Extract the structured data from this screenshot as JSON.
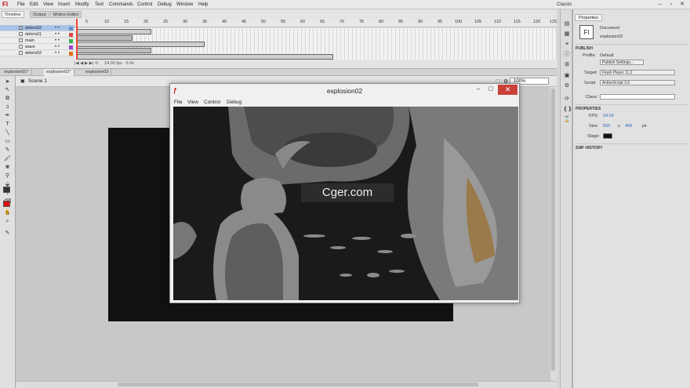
{
  "menubar": {
    "logo": "Fl",
    "items": [
      "File",
      "Edit",
      "View",
      "Insert",
      "Modify",
      "Text",
      "Commands",
      "Control",
      "Debug",
      "Window",
      "Help"
    ],
    "workspace": "Classic"
  },
  "timeline": {
    "tabs": [
      "Timeline",
      "Output",
      "Motion Editor"
    ],
    "layers": [
      {
        "name": "debris02",
        "color": "#6a8ecf"
      },
      {
        "name": "debris01",
        "color": "#d44"
      },
      {
        "name": "main",
        "color": "#3cb44b"
      },
      {
        "name": "wave",
        "color": "#9b3fc6"
      },
      {
        "name": "debris02",
        "color": "#e06b1a"
      }
    ],
    "frame_numbers": [
      "5",
      "10",
      "15",
      "20",
      "25",
      "30",
      "35",
      "40",
      "45",
      "50",
      "55",
      "60",
      "65",
      "70",
      "75",
      "80",
      "85",
      "90",
      "95",
      "100",
      "105",
      "110",
      "115",
      "120",
      "125"
    ],
    "fps": "24.00 fps",
    "time": "0.0s"
  },
  "doc_tabs": [
    "explosion01*",
    "explosion02*",
    "explosion03"
  ],
  "scene": {
    "label": "Scene 1",
    "zoom": "100%"
  },
  "player": {
    "title": "explosion02",
    "menus": [
      "File",
      "View",
      "Control",
      "Debug"
    ]
  },
  "properties": {
    "tab": "Properties",
    "doc_type": "Document",
    "doc_name": "explosion02",
    "publish_header": "PUBLISH",
    "profile_label": "Profile:",
    "profile_value": "Default",
    "publish_settings": "Publish Settings...",
    "target_label": "Target:",
    "target_value": "Flash Player 11.2",
    "script_label": "Script:",
    "script_value": "ActionScript 3.0",
    "class_label": "Class:",
    "props_header": "PROPERTIES",
    "fps_label": "FPS:",
    "fps_value": "24.00",
    "size_label": "Size:",
    "size_w": "550",
    "size_x": "x",
    "size_h": "400",
    "size_unit": "px",
    "stage_label": "Stage:",
    "swf_header": "SWF HISTORY"
  },
  "watermark": "Cger.com",
  "colors": {
    "accent": "#a7c3e6",
    "close": "#c9403a"
  }
}
